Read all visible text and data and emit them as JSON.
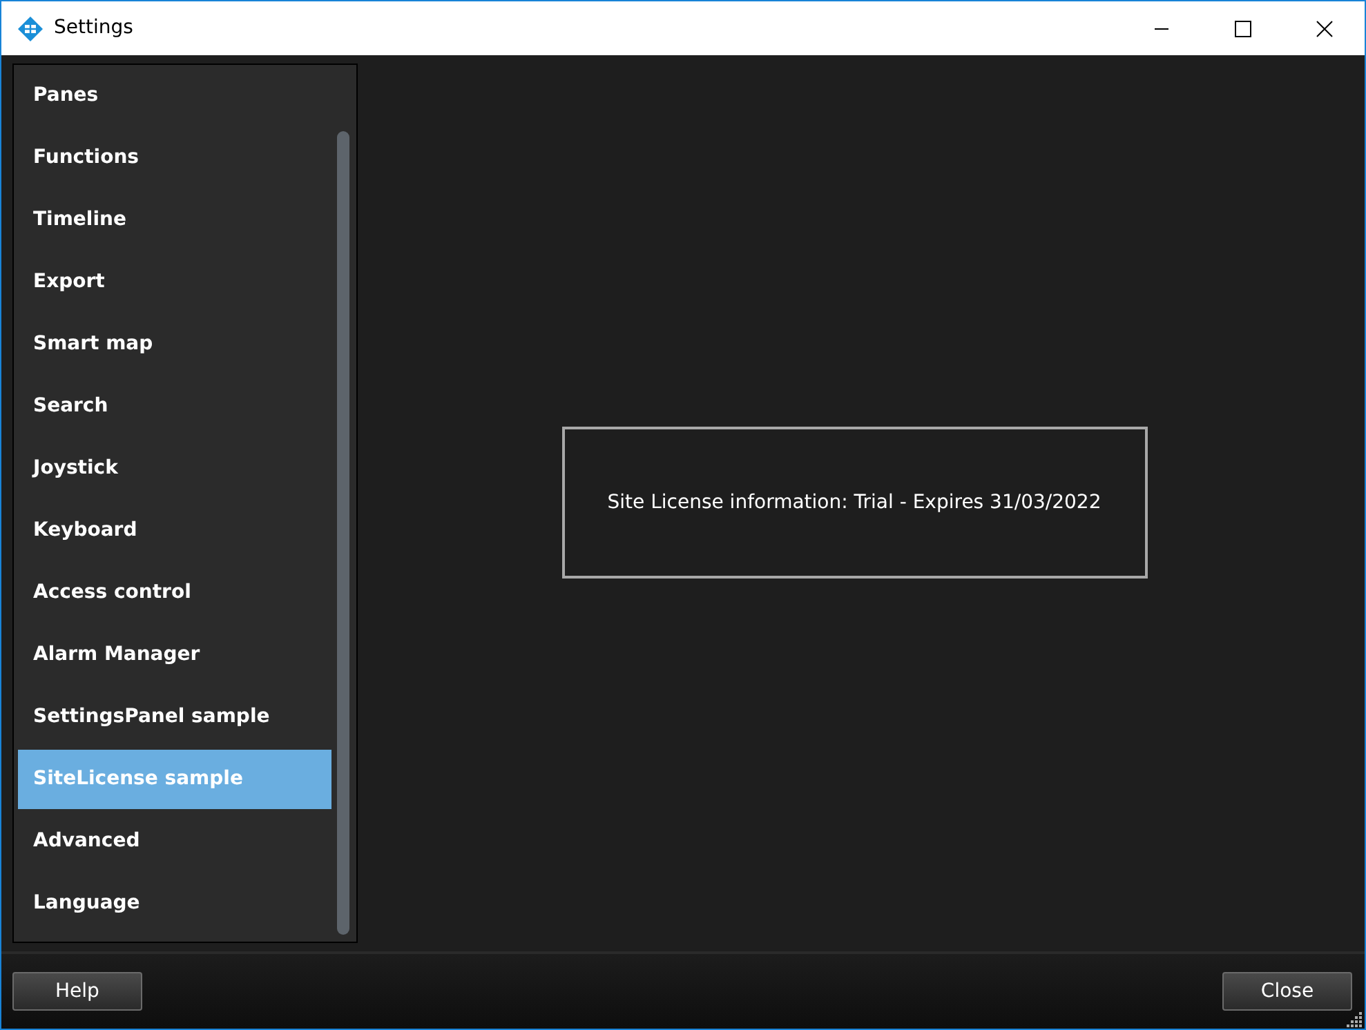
{
  "window": {
    "title": "Settings"
  },
  "sidebar": {
    "items": [
      {
        "label": "Panes",
        "selected": false
      },
      {
        "label": "Functions",
        "selected": false
      },
      {
        "label": "Timeline",
        "selected": false
      },
      {
        "label": "Export",
        "selected": false
      },
      {
        "label": "Smart map",
        "selected": false
      },
      {
        "label": "Search",
        "selected": false
      },
      {
        "label": "Joystick",
        "selected": false
      },
      {
        "label": "Keyboard",
        "selected": false
      },
      {
        "label": "Access control",
        "selected": false
      },
      {
        "label": "Alarm Manager",
        "selected": false
      },
      {
        "label": "SettingsPanel sample",
        "selected": false
      },
      {
        "label": "SiteLicense sample",
        "selected": true
      },
      {
        "label": "Advanced",
        "selected": false
      },
      {
        "label": "Language",
        "selected": false
      }
    ]
  },
  "panel": {
    "info": "Site License information: Trial - Expires 31/03/2022"
  },
  "buttons": {
    "help": "Help",
    "close": "Close"
  }
}
